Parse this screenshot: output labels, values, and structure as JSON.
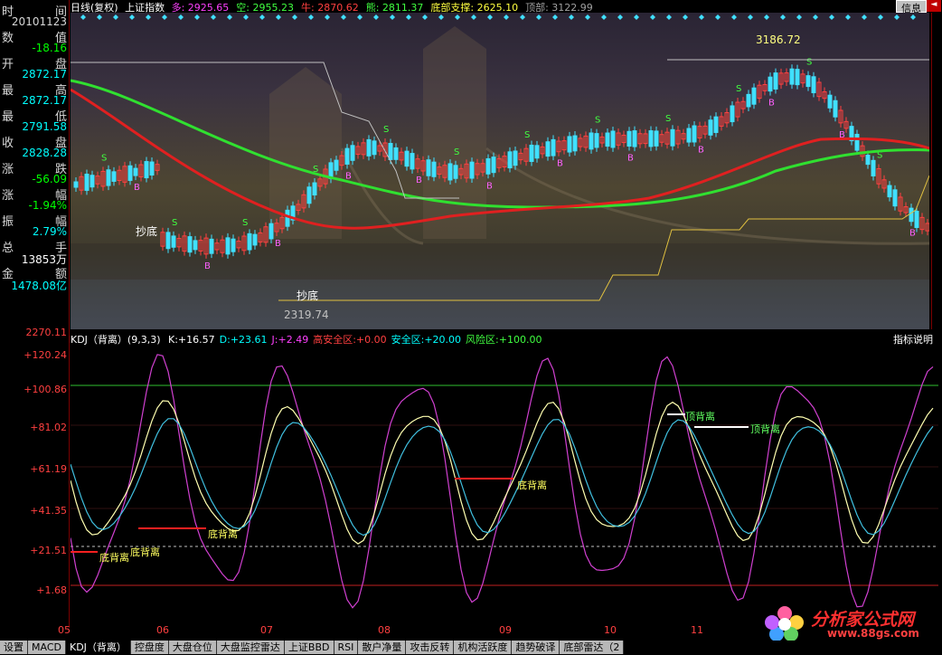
{
  "left_panel": {
    "rows": [
      {
        "label": "时",
        "label2": "间",
        "value": "20101123",
        "color": "#d8d8d8"
      },
      {
        "label": "数",
        "label2": "值",
        "value": "-18.16",
        "color": "#00ff00"
      },
      {
        "label": "开",
        "label2": "盘",
        "value": "2872.17",
        "color": "#00ffff"
      },
      {
        "label": "最",
        "label2": "高",
        "value": "2872.17",
        "color": "#00ffff"
      },
      {
        "label": "最",
        "label2": "低",
        "value": "2791.58",
        "color": "#00ffff"
      },
      {
        "label": "收",
        "label2": "盘",
        "value": "2828.28",
        "color": "#00ffff"
      },
      {
        "label": "涨",
        "label2": "跌",
        "value": "-56.09",
        "color": "#00ff00"
      },
      {
        "label": "涨",
        "label2": "幅",
        "value": "-1.94%",
        "color": "#00ff00"
      },
      {
        "label": "振",
        "label2": "幅",
        "value": "2.79%",
        "color": "#00ffff"
      },
      {
        "label": "总",
        "label2": "手",
        "value": "13853万",
        "color": "#ffffff"
      },
      {
        "label": "金",
        "label2": "额",
        "value": "1478.08亿",
        "color": "#00ffff"
      }
    ],
    "kdj_top_value": "2270.11"
  },
  "header": {
    "title": "日线(复权)",
    "index_name": "上证指数",
    "items": [
      {
        "label": "多:",
        "value": "2925.65",
        "color": "#ff40ff"
      },
      {
        "label": "空:",
        "value": "2955.23",
        "color": "#40ff40"
      },
      {
        "label": "牛:",
        "value": "2870.62",
        "color": "#ff4040"
      },
      {
        "label": "熊:",
        "value": "2811.37",
        "color": "#40ff40"
      },
      {
        "label": "底部支撑:",
        "value": "2625.10",
        "color": "#ffff40"
      },
      {
        "label": "顶部:",
        "value": "3122.99",
        "color": "#a0a0a0"
      }
    ],
    "info_button": "信息",
    "arrow_left": "◄",
    "arrow_right": "►"
  },
  "price_chart": {
    "high_label": "3186.72",
    "low_label": "2319.74",
    "annotations": [
      "抄底",
      "抄底"
    ],
    "signals_s": "S",
    "signals_b": "B"
  },
  "kdj": {
    "title": "KDJ（背离）(9,3,3)",
    "items": [
      {
        "label": "K:",
        "value": "+16.57",
        "color": "#ffffff"
      },
      {
        "label": "D:",
        "value": "+23.61",
        "color": "#00ffff"
      },
      {
        "label": "J:",
        "value": "+2.49",
        "color": "#ff40ff"
      },
      {
        "label": "高安全区:",
        "value": "+0.00",
        "color": "#ff4040"
      },
      {
        "label": "安全区:",
        "value": "+20.00",
        "color": "#00ffff"
      },
      {
        "label": "风险区:",
        "value": "+100.00",
        "color": "#40ff40"
      }
    ],
    "help_button": "指标说明",
    "yticks": [
      "+120.24",
      "+100.86",
      "+81.02",
      "+61.19",
      "+41.35",
      "+21.51",
      "+1.68"
    ],
    "divergence_labels": [
      "底背离",
      "底背离",
      "底背离",
      "底背离",
      "顶背离",
      "顶背离"
    ],
    "months": [
      "05",
      "06",
      "07",
      "08",
      "09",
      "10",
      "11"
    ]
  },
  "chart_data": {
    "type": "line",
    "title": "KDJ（背离）(9,3,3)",
    "x": [
      "05",
      "06",
      "07",
      "08",
      "09",
      "10",
      "11"
    ],
    "ylim": [
      1.68,
      120.24
    ],
    "series": [
      {
        "name": "K",
        "values": [
          18,
          62,
          30,
          90,
          58,
          95,
          88,
          16.57
        ]
      },
      {
        "name": "D",
        "values": [
          20,
          58,
          28,
          86,
          56,
          92,
          86,
          23.61
        ]
      },
      {
        "name": "J",
        "values": [
          10,
          100,
          10,
          110,
          45,
          118,
          95,
          2.49
        ]
      }
    ]
  },
  "tabs": [
    "设置",
    "MACD",
    "KDJ（背离）",
    "控盘度",
    "大盘仓位",
    "大盘监控雷达",
    "上证BBD",
    "RSI",
    "散户净量",
    "攻击反转",
    "机构活跃度",
    "趋势破译",
    "底部雷达（2"
  ],
  "logo_text": "分析家公式网",
  "logo_url": "www.88gs.com"
}
